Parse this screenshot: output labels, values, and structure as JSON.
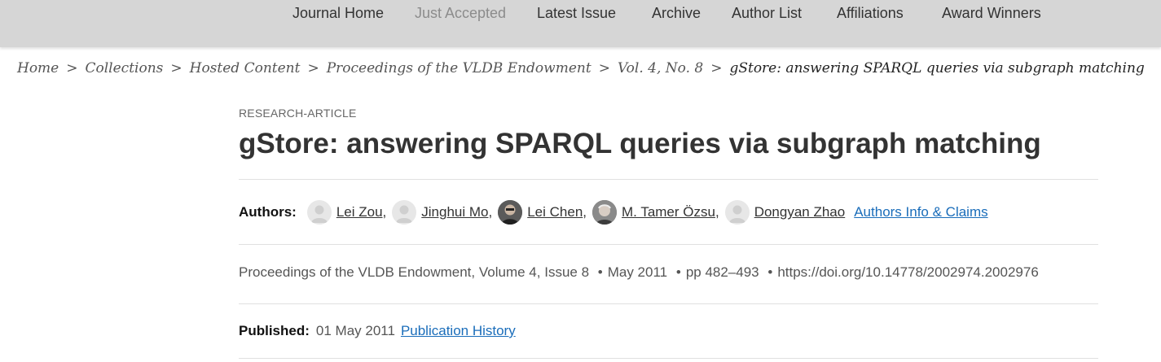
{
  "nav": {
    "items": [
      {
        "label": "Journal Home"
      },
      {
        "label": "Just Accepted"
      },
      {
        "label": "Latest Issue"
      },
      {
        "label": "Archive"
      },
      {
        "label": "Author List"
      },
      {
        "label": "Affiliations"
      },
      {
        "label": "Award Winners"
      }
    ]
  },
  "breadcrumb": {
    "separator": ">",
    "items": [
      {
        "label": "Home"
      },
      {
        "label": "Collections"
      },
      {
        "label": "Hosted Content"
      },
      {
        "label": "Proceedings of the VLDB Endowment"
      },
      {
        "label": "Vol. 4, No. 8"
      },
      {
        "label": "gStore: answering SPARQL queries via subgraph matching"
      }
    ]
  },
  "article": {
    "type": "RESEARCH-ARTICLE",
    "title": "gStore: answering SPARQL queries via subgraph matching",
    "authors_label": "Authors:",
    "authors": [
      {
        "name": "Lei Zou",
        "avatar": "default-avatar-icon"
      },
      {
        "name": "Jinghui Mo",
        "avatar": "default-avatar-icon"
      },
      {
        "name": "Lei Chen",
        "avatar": "photo"
      },
      {
        "name": "M. Tamer Özsu",
        "avatar": "photo"
      },
      {
        "name": "Dongyan Zhao",
        "avatar": "default-avatar-icon"
      }
    ],
    "comma": ",",
    "authors_info_link": "Authors Info & Claims",
    "publication": {
      "journal": "Proceedings of the VLDB Endowment",
      "volume": "Volume 4",
      "issue": "Issue 8",
      "date": "May 2011",
      "pages": "pp 482–493",
      "doi": "https://doi.org/10.14778/2002974.2002976",
      "comma": ",",
      "bullet": "•"
    },
    "published_label": "Published:",
    "published_date": "01 May 2011",
    "publication_history_link": "Publication History"
  },
  "colors": {
    "nav_bg": "#d6d6d6",
    "link": "#1a6dba",
    "text": "#333333",
    "muted": "#8c8c8c"
  }
}
